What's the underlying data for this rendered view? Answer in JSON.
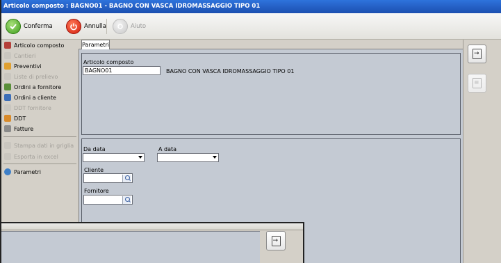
{
  "window": {
    "title": "Articolo composto : BAGNO01 - BAGNO CON VASCA IDROMASSAGGIO TIPO 01"
  },
  "toolbar": {
    "confirm_label": "Conferma",
    "cancel_label": "Annulla",
    "help_label": "Aiuto"
  },
  "sidebar": {
    "items": [
      {
        "label": "Articolo composto",
        "enabled": true,
        "color": "#b5403a"
      },
      {
        "label": "Cantieri",
        "enabled": false,
        "color": "#c9c6bf"
      },
      {
        "label": "Preventivi",
        "enabled": true,
        "color": "#e0a030"
      },
      {
        "label": "Liste di prelievo",
        "enabled": false,
        "color": "#c9c6bf"
      },
      {
        "label": "Ordini a fornitore",
        "enabled": true,
        "color": "#5a8f3a"
      },
      {
        "label": "Ordini a cliente",
        "enabled": true,
        "color": "#3d6fb8"
      },
      {
        "label": "DDT fornitore",
        "enabled": false,
        "color": "#c9c6bf"
      },
      {
        "label": "DDT",
        "enabled": true,
        "color": "#d88a2a"
      },
      {
        "label": "Fatture",
        "enabled": true,
        "color": "#8a8a8a"
      },
      {
        "label": "Stampa dati in griglia",
        "enabled": false,
        "color": "#c9c6bf"
      },
      {
        "label": "Esporta in excel",
        "enabled": false,
        "color": "#c9c6bf"
      },
      {
        "label": "Parametri",
        "enabled": true,
        "color": "#3d7fc8"
      }
    ]
  },
  "tabs": [
    {
      "label": "Parametri",
      "active": true
    }
  ],
  "form": {
    "articolo_label": "Articolo composto",
    "articolo_code": "BAGNO01",
    "articolo_description": "BAGNO CON VASCA IDROMASSAGGIO TIPO 01",
    "da_data_label": "Da data",
    "da_data_value": "",
    "a_data_label": "A data",
    "a_data_value": "",
    "cliente_label": "Cliente",
    "cliente_value": "",
    "fornitore_label": "Fornitore",
    "fornitore_value": ""
  },
  "right_buttons": [
    {
      "icon": "export-document-icon",
      "enabled": true
    },
    {
      "icon": "list-document-icon",
      "enabled": false
    }
  ],
  "colors": {
    "titlebar": "#1c4fb0",
    "panel": "#c4cad3",
    "chrome": "#d4d0c8"
  }
}
